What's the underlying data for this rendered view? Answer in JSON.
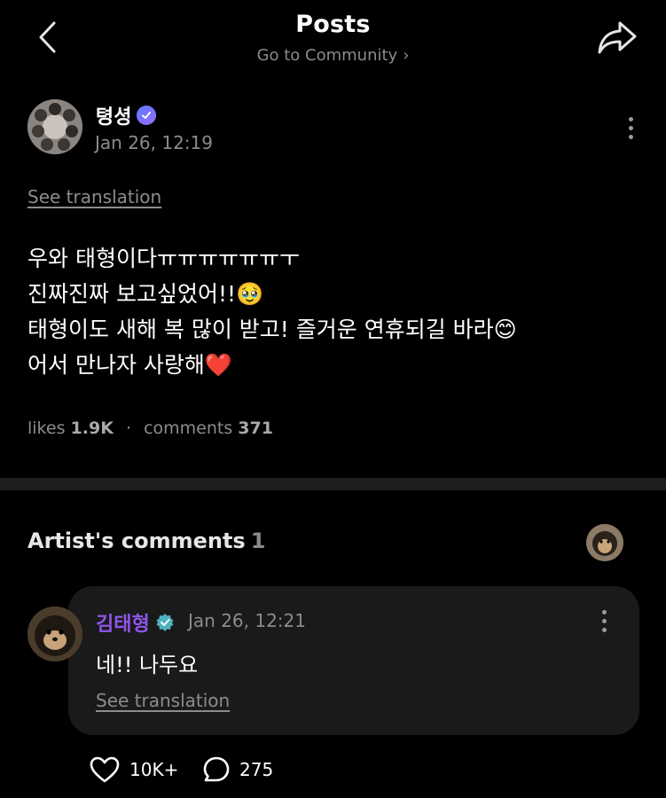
{
  "header": {
    "title": "Posts",
    "subtitle": "Go to Community",
    "back_icon": "chevron-left-icon",
    "share_icon": "share-arrow-icon"
  },
  "post": {
    "author": "텽셩",
    "date": "Jan 26, 12:19",
    "see_translation": "See translation",
    "body_lines": [
      "우와 태형이다ㅠㅠㅠㅠㅠㅠㅜ",
      "진짜진짜 보고싶었어!!🥹",
      "태형이도 새해 복 많이 받고! 즐거운 연휴되길 바라😊",
      "어서 만나자 사랑해❤️"
    ],
    "likes_label": "likes",
    "likes_value": "1.9K",
    "comments_label": "comments",
    "comments_value": "371"
  },
  "artist_comments": {
    "title": "Artist's comments",
    "count": "1",
    "comment": {
      "author": "김태형",
      "date": "Jan 26, 12:21",
      "text": "네!! 나두요",
      "see_translation": "See translation",
      "likes": "10K+",
      "replies": "275"
    }
  },
  "colors": {
    "background": "#000000",
    "muted_text": "#8c8c8c",
    "artist_name": "#8e55e8",
    "verified_badge": "#4fb3bf",
    "card": "#1a1a1a"
  }
}
